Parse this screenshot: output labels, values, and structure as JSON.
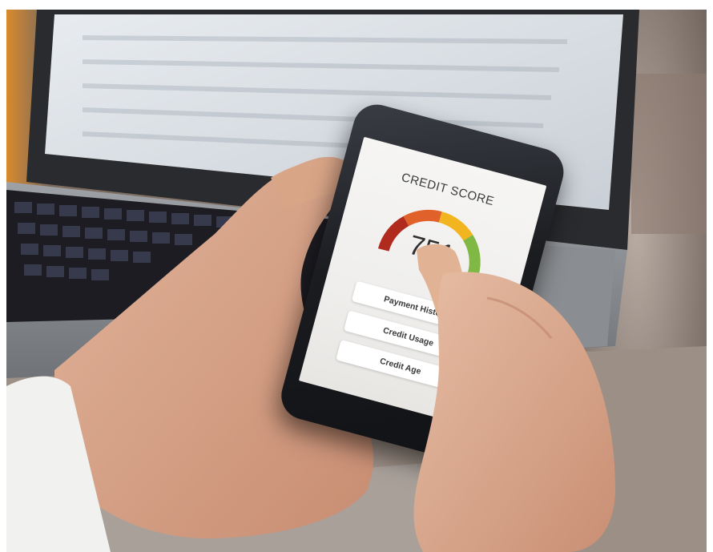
{
  "phone_app": {
    "title": "CREDIT SCORE",
    "score": "751",
    "gauge_colors": [
      "#b02a1e",
      "#e0612a",
      "#f2b51f",
      "#7fb845"
    ],
    "buttons": [
      {
        "label": "Payment History"
      },
      {
        "label": "Credit Usage"
      },
      {
        "label": "Credit Age"
      }
    ]
  }
}
